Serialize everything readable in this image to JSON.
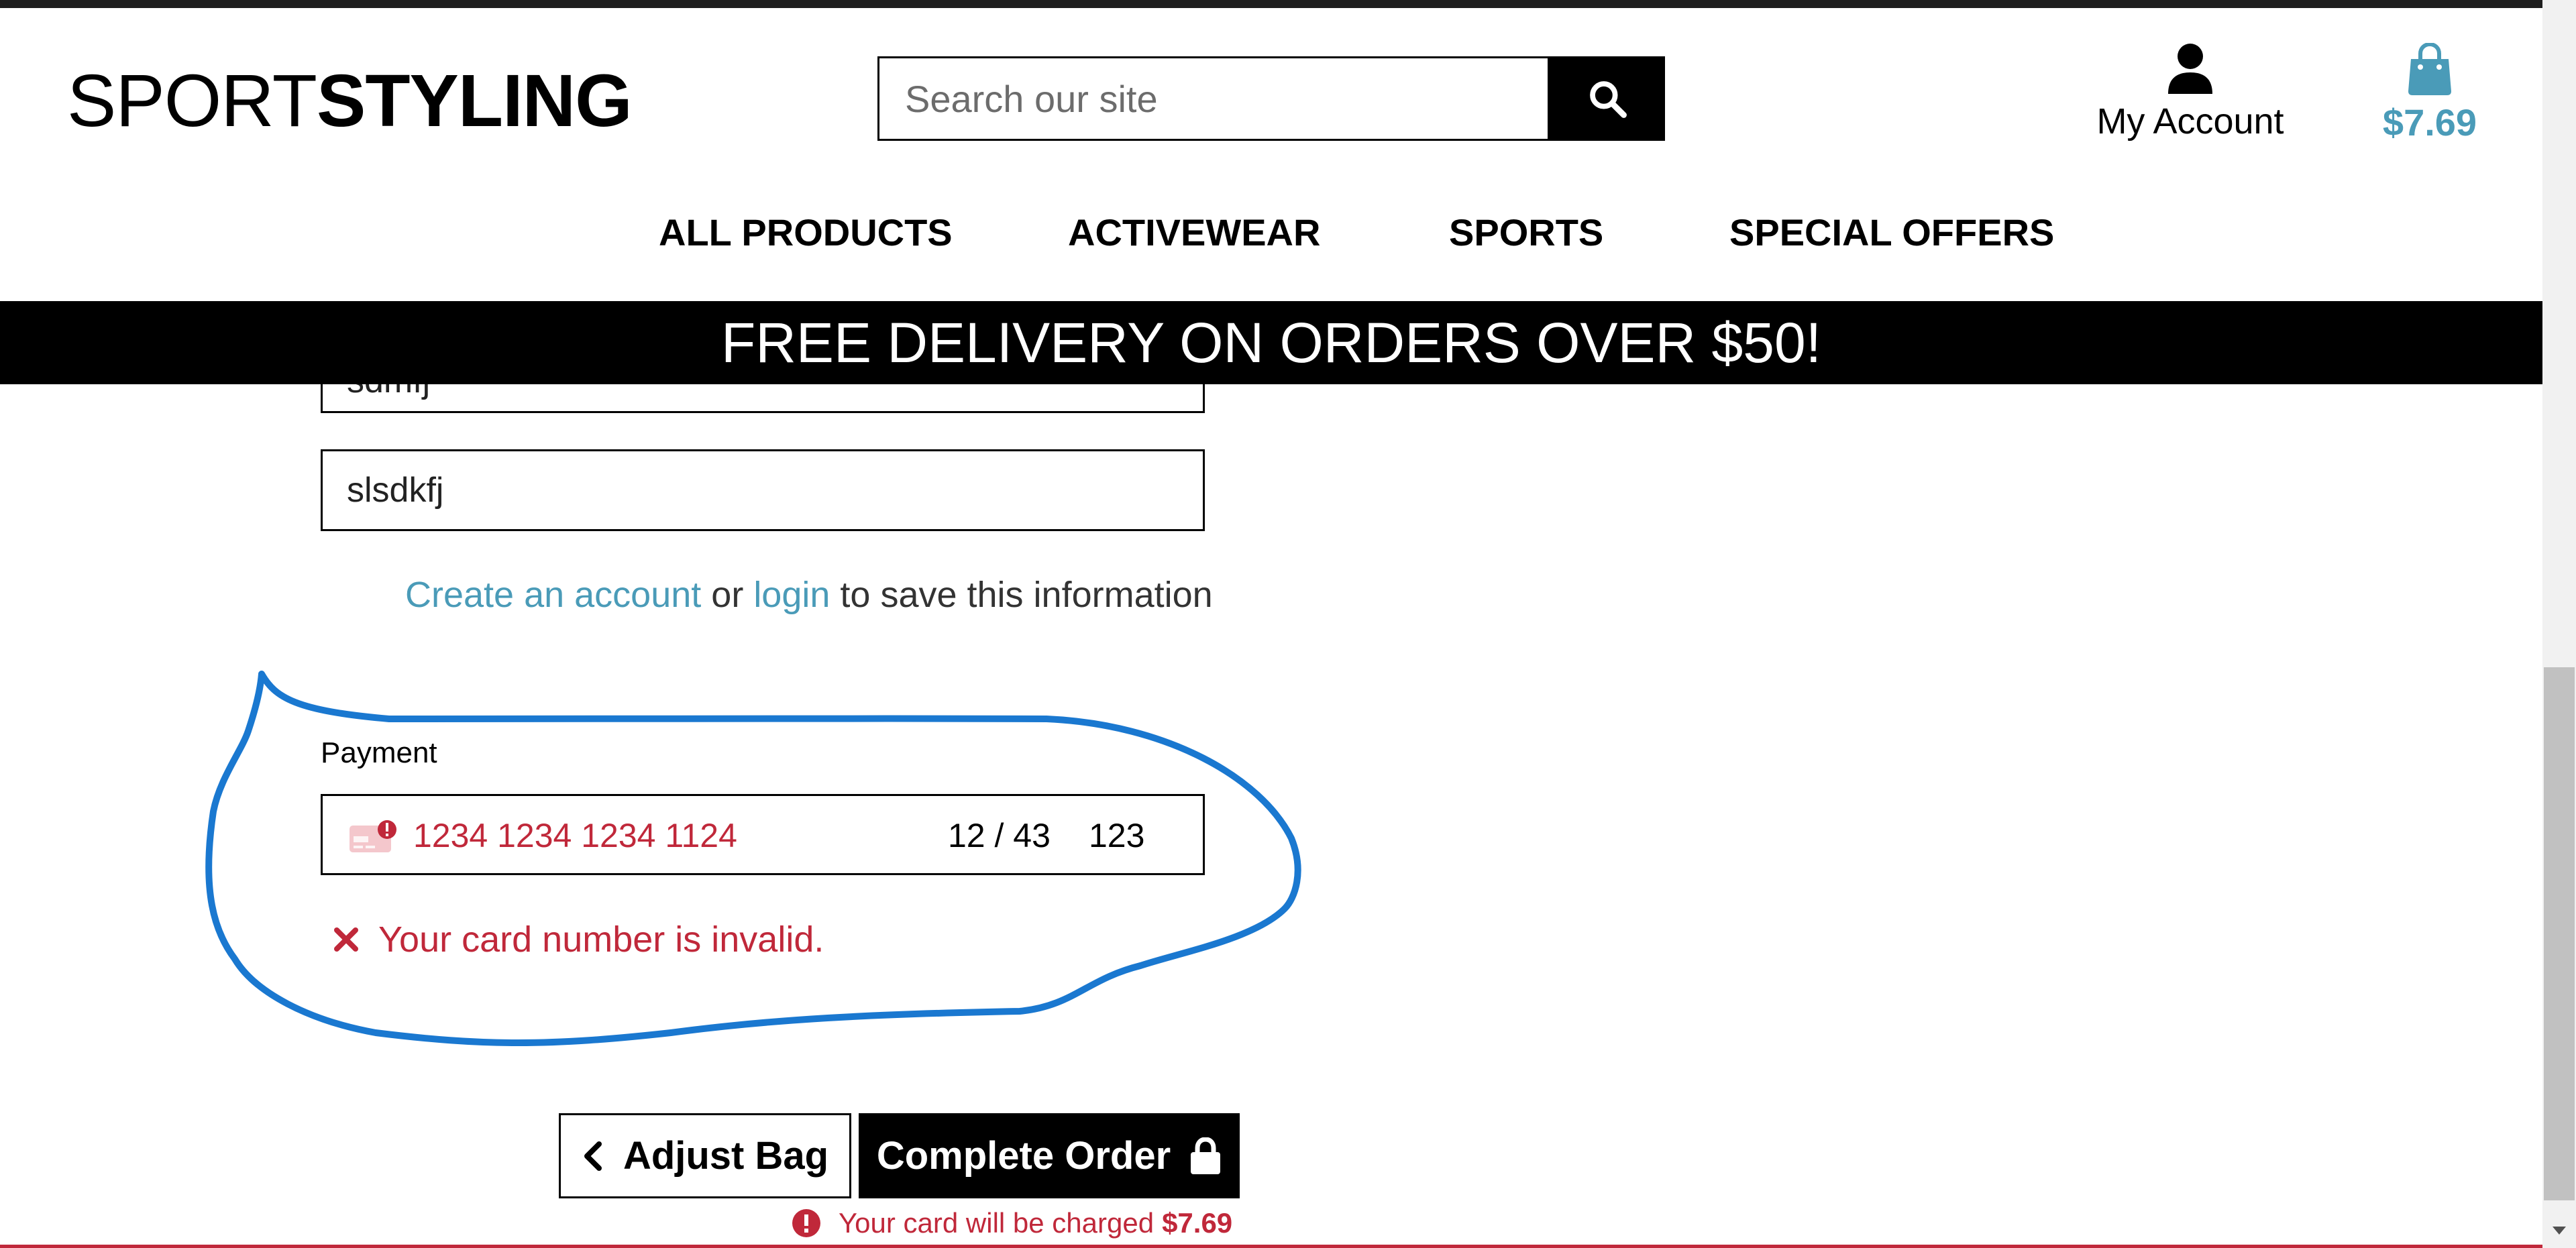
{
  "brand": {
    "part1": "SPORT",
    "part2": "STYLING"
  },
  "search": {
    "placeholder": "Search our site",
    "icon": "search-icon"
  },
  "account": {
    "label": "My Account",
    "icon": "user-icon"
  },
  "bag": {
    "total": "$7.69",
    "icon": "shopping-bag-icon"
  },
  "nav": {
    "items": [
      {
        "label": "ALL PRODUCTS"
      },
      {
        "label": "ACTIVEWEAR"
      },
      {
        "label": "SPORTS"
      },
      {
        "label": "SPECIAL OFFERS"
      }
    ]
  },
  "banner": {
    "text": "FREE DELIVERY ON ORDERS OVER $50!"
  },
  "form": {
    "field_partial_value": "sdmfj",
    "field_value": "slsdkfj",
    "save_info": {
      "create_link": "Create an account",
      "or": " or ",
      "login_link": "login",
      "suffix": " to save this information"
    }
  },
  "payment": {
    "label": "Payment",
    "card_number": "1234 1234 1234 1124",
    "expiry": "12 / 43",
    "cvc": "123",
    "card_icon": "card-error-icon",
    "error": "Your card number is invalid."
  },
  "buttons": {
    "adjust_bag": "Adjust Bag",
    "complete_order": "Complete Order"
  },
  "charge_note": {
    "text": "Your card will be charged",
    "amount": "$7.69"
  },
  "colors": {
    "accent": "#4a9bb8",
    "error": "#c0283a",
    "annotation": "#1a78d0",
    "black": "#000000"
  }
}
